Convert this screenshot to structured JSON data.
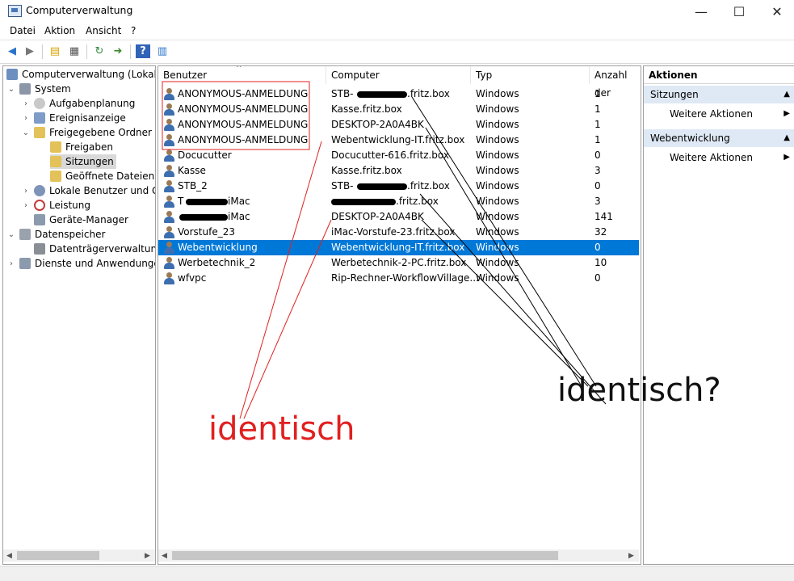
{
  "window": {
    "title": "Computerverwaltung"
  },
  "menu": [
    "Datei",
    "Aktion",
    "Ansicht",
    "?"
  ],
  "tree": [
    {
      "label": "Computerverwaltung (Lokal)"
    },
    {
      "label": "System"
    },
    {
      "label": "Aufgabenplanung"
    },
    {
      "label": "Ereignisanzeige"
    },
    {
      "label": "Freigegebene Ordner"
    },
    {
      "label": "Freigaben"
    },
    {
      "label": "Sitzungen"
    },
    {
      "label": "Geöffnete Dateien"
    },
    {
      "label": "Lokale Benutzer und Gru"
    },
    {
      "label": "Leistung"
    },
    {
      "label": "Geräte-Manager"
    },
    {
      "label": "Datenspeicher"
    },
    {
      "label": "Datenträgerverwaltung"
    },
    {
      "label": "Dienste und Anwendungen"
    }
  ],
  "table": {
    "columns": [
      "Benutzer",
      "Computer",
      "Typ",
      "Anzahl der"
    ],
    "rows": [
      {
        "user": "ANONYMOUS-ANMELDUNG",
        "computer": "STB-",
        "computer_suffix": ".fritz.box",
        "type": "Windows",
        "count": "1"
      },
      {
        "user": "ANONYMOUS-ANMELDUNG",
        "computer": "Kasse.fritz.box",
        "computer_suffix": "",
        "type": "Windows",
        "count": "1"
      },
      {
        "user": "ANONYMOUS-ANMELDUNG",
        "computer": "DESKTOP-2A0A4BK",
        "computer_suffix": "",
        "type": "Windows",
        "count": "1"
      },
      {
        "user": "ANONYMOUS-ANMELDUNG",
        "computer": "Webentwicklung-IT.fritz.box",
        "computer_suffix": "",
        "type": "Windows",
        "count": "1"
      },
      {
        "user": "Docucutter",
        "computer": "Docucutter-616.fritz.box",
        "computer_suffix": "",
        "type": "Windows",
        "count": "0"
      },
      {
        "user": "Kasse",
        "computer": "Kasse.fritz.box",
        "computer_suffix": "",
        "type": "Windows",
        "count": "3"
      },
      {
        "user": "STB_2",
        "computer": "STB-",
        "computer_suffix": ".fritz.box",
        "type": "Windows",
        "count": "0"
      },
      {
        "user": "T",
        "user_suffix": "iMac",
        "computer": "",
        "computer_suffix": ".fritz.box",
        "type": "Windows",
        "count": "3"
      },
      {
        "user": "",
        "user_suffix": "iMac",
        "computer": "DESKTOP-2A0A4BK",
        "computer_suffix": "",
        "type": "Windows",
        "count": "141"
      },
      {
        "user": "Vorstufe_23",
        "computer": "iMac-Vorstufe-23.fritz.box",
        "computer_suffix": "",
        "type": "Windows",
        "count": "32"
      },
      {
        "user": "Webentwicklung",
        "computer": "Webentwicklung-IT.fritz.box",
        "computer_suffix": "",
        "type": "Windows",
        "count": "0"
      },
      {
        "user": "Werbetechnik_2",
        "computer": "Werbetechnik-2-PC.fritz.box",
        "computer_suffix": "",
        "type": "Windows",
        "count": "10"
      },
      {
        "user": "wfvpc",
        "computer": "Rip-Rechner-WorkflowVillage...",
        "computer_suffix": "",
        "type": "Windows",
        "count": "0"
      }
    ]
  },
  "actions": {
    "header": "Aktionen",
    "sections": [
      {
        "title": "Sitzungen",
        "item": "Weitere Aktionen"
      },
      {
        "title": "Webentwicklung",
        "item": "Weitere Aktionen"
      }
    ]
  },
  "annotations": {
    "red": "identisch",
    "black": "identisch?"
  },
  "colors": {
    "selection": "#0078d7",
    "annotation_red": "#e0201f",
    "section_bg": "#dfe9f5"
  }
}
